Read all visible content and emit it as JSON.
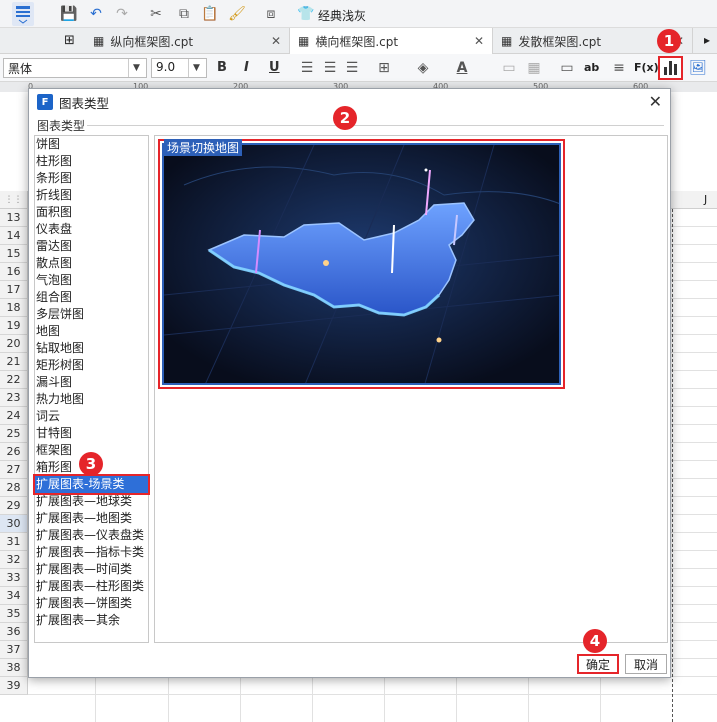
{
  "toolbar": {
    "theme_label": "经典浅灰"
  },
  "tabs": [
    {
      "label": "纵向框架图.cpt"
    },
    {
      "label": "横向框架图.cpt"
    },
    {
      "label": "发散框架图.cpt"
    }
  ],
  "format_bar": {
    "font_family": "黑体",
    "font_size": "9.0",
    "bold": "B",
    "italic": "I",
    "underline": "U",
    "fx": "F(x)",
    "ab": "ab"
  },
  "ruler": {
    "ticks": [
      "0",
      "100",
      "200",
      "300",
      "400",
      "500",
      "600"
    ]
  },
  "sheet": {
    "rows": [
      "13",
      "14",
      "15",
      "16",
      "17",
      "18",
      "19",
      "20",
      "21",
      "22",
      "23",
      "24",
      "25",
      "26",
      "27",
      "28",
      "29",
      "30",
      "31",
      "32",
      "33",
      "34",
      "35",
      "36",
      "37",
      "38",
      "39"
    ],
    "highlighted_row": "30",
    "col_label": "J"
  },
  "dialog": {
    "title": "图表类型",
    "group_label": "图表类型",
    "chart_types": [
      "饼图",
      "柱形图",
      "条形图",
      "折线图",
      "面积图",
      "仪表盘",
      "雷达图",
      "散点图",
      "气泡图",
      "组合图",
      "多层饼图",
      "地图",
      "钻取地图",
      "矩形树图",
      "漏斗图",
      "热力地图",
      "词云",
      "甘特图",
      "框架图",
      "箱形图",
      "扩展图表-场景类",
      "扩展图表—地球类",
      "扩展图表—地图类",
      "扩展图表—仪表盘类",
      "扩展图表—指标卡类",
      "扩展图表—时间类",
      "扩展图表—柱形图类",
      "扩展图表—饼图类",
      "扩展图表—其余"
    ],
    "selected_index": 20,
    "preview_caption": "场景切换地图",
    "ok_label": "确定",
    "cancel_label": "取消"
  },
  "badges": [
    "1",
    "2",
    "3",
    "4"
  ],
  "colors": {
    "accent_red": "#e5252a",
    "selection_blue": "#2e6fd8",
    "preview_bg": "#0c1224"
  }
}
